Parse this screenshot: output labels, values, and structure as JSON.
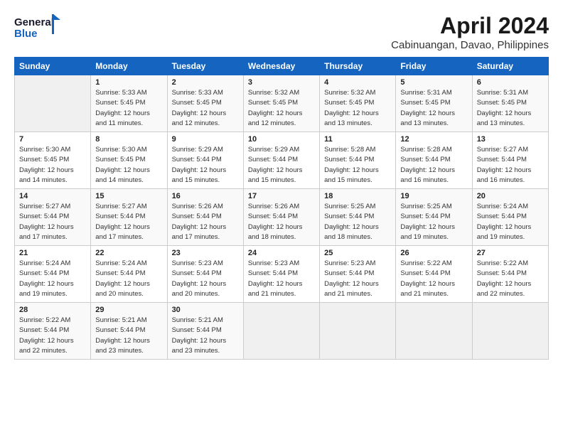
{
  "header": {
    "logo_line1": "General",
    "logo_line2": "Blue",
    "title": "April 2024",
    "subtitle": "Cabinuangan, Davao, Philippines"
  },
  "columns": [
    "Sunday",
    "Monday",
    "Tuesday",
    "Wednesday",
    "Thursday",
    "Friday",
    "Saturday"
  ],
  "rows": [
    [
      {
        "day": "",
        "text": ""
      },
      {
        "day": "1",
        "text": "Sunrise: 5:33 AM\nSunset: 5:45 PM\nDaylight: 12 hours\nand 11 minutes."
      },
      {
        "day": "2",
        "text": "Sunrise: 5:33 AM\nSunset: 5:45 PM\nDaylight: 12 hours\nand 12 minutes."
      },
      {
        "day": "3",
        "text": "Sunrise: 5:32 AM\nSunset: 5:45 PM\nDaylight: 12 hours\nand 12 minutes."
      },
      {
        "day": "4",
        "text": "Sunrise: 5:32 AM\nSunset: 5:45 PM\nDaylight: 12 hours\nand 13 minutes."
      },
      {
        "day": "5",
        "text": "Sunrise: 5:31 AM\nSunset: 5:45 PM\nDaylight: 12 hours\nand 13 minutes."
      },
      {
        "day": "6",
        "text": "Sunrise: 5:31 AM\nSunset: 5:45 PM\nDaylight: 12 hours\nand 13 minutes."
      }
    ],
    [
      {
        "day": "7",
        "text": "Sunrise: 5:30 AM\nSunset: 5:45 PM\nDaylight: 12 hours\nand 14 minutes."
      },
      {
        "day": "8",
        "text": "Sunrise: 5:30 AM\nSunset: 5:45 PM\nDaylight: 12 hours\nand 14 minutes."
      },
      {
        "day": "9",
        "text": "Sunrise: 5:29 AM\nSunset: 5:44 PM\nDaylight: 12 hours\nand 15 minutes."
      },
      {
        "day": "10",
        "text": "Sunrise: 5:29 AM\nSunset: 5:44 PM\nDaylight: 12 hours\nand 15 minutes."
      },
      {
        "day": "11",
        "text": "Sunrise: 5:28 AM\nSunset: 5:44 PM\nDaylight: 12 hours\nand 15 minutes."
      },
      {
        "day": "12",
        "text": "Sunrise: 5:28 AM\nSunset: 5:44 PM\nDaylight: 12 hours\nand 16 minutes."
      },
      {
        "day": "13",
        "text": "Sunrise: 5:27 AM\nSunset: 5:44 PM\nDaylight: 12 hours\nand 16 minutes."
      }
    ],
    [
      {
        "day": "14",
        "text": "Sunrise: 5:27 AM\nSunset: 5:44 PM\nDaylight: 12 hours\nand 17 minutes."
      },
      {
        "day": "15",
        "text": "Sunrise: 5:27 AM\nSunset: 5:44 PM\nDaylight: 12 hours\nand 17 minutes."
      },
      {
        "day": "16",
        "text": "Sunrise: 5:26 AM\nSunset: 5:44 PM\nDaylight: 12 hours\nand 17 minutes."
      },
      {
        "day": "17",
        "text": "Sunrise: 5:26 AM\nSunset: 5:44 PM\nDaylight: 12 hours\nand 18 minutes."
      },
      {
        "day": "18",
        "text": "Sunrise: 5:25 AM\nSunset: 5:44 PM\nDaylight: 12 hours\nand 18 minutes."
      },
      {
        "day": "19",
        "text": "Sunrise: 5:25 AM\nSunset: 5:44 PM\nDaylight: 12 hours\nand 19 minutes."
      },
      {
        "day": "20",
        "text": "Sunrise: 5:24 AM\nSunset: 5:44 PM\nDaylight: 12 hours\nand 19 minutes."
      }
    ],
    [
      {
        "day": "21",
        "text": "Sunrise: 5:24 AM\nSunset: 5:44 PM\nDaylight: 12 hours\nand 19 minutes."
      },
      {
        "day": "22",
        "text": "Sunrise: 5:24 AM\nSunset: 5:44 PM\nDaylight: 12 hours\nand 20 minutes."
      },
      {
        "day": "23",
        "text": "Sunrise: 5:23 AM\nSunset: 5:44 PM\nDaylight: 12 hours\nand 20 minutes."
      },
      {
        "day": "24",
        "text": "Sunrise: 5:23 AM\nSunset: 5:44 PM\nDaylight: 12 hours\nand 21 minutes."
      },
      {
        "day": "25",
        "text": "Sunrise: 5:23 AM\nSunset: 5:44 PM\nDaylight: 12 hours\nand 21 minutes."
      },
      {
        "day": "26",
        "text": "Sunrise: 5:22 AM\nSunset: 5:44 PM\nDaylight: 12 hours\nand 21 minutes."
      },
      {
        "day": "27",
        "text": "Sunrise: 5:22 AM\nSunset: 5:44 PM\nDaylight: 12 hours\nand 22 minutes."
      }
    ],
    [
      {
        "day": "28",
        "text": "Sunrise: 5:22 AM\nSunset: 5:44 PM\nDaylight: 12 hours\nand 22 minutes."
      },
      {
        "day": "29",
        "text": "Sunrise: 5:21 AM\nSunset: 5:44 PM\nDaylight: 12 hours\nand 23 minutes."
      },
      {
        "day": "30",
        "text": "Sunrise: 5:21 AM\nSunset: 5:44 PM\nDaylight: 12 hours\nand 23 minutes."
      },
      {
        "day": "",
        "text": ""
      },
      {
        "day": "",
        "text": ""
      },
      {
        "day": "",
        "text": ""
      },
      {
        "day": "",
        "text": ""
      }
    ]
  ]
}
